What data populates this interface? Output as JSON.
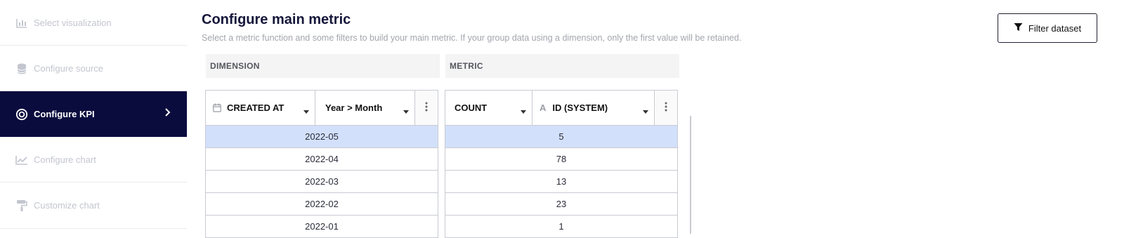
{
  "sidebar": {
    "steps": [
      {
        "label": "Select visualization",
        "icon": "bar-chart-icon",
        "active": false
      },
      {
        "label": "Configure source",
        "icon": "database-icon",
        "active": false
      },
      {
        "label": "Configure KPI",
        "icon": "target-icon",
        "active": true
      },
      {
        "label": "Configure chart",
        "icon": "line-chart-icon",
        "active": false
      },
      {
        "label": "Customize chart",
        "icon": "paint-roller-icon",
        "active": false
      }
    ]
  },
  "header": {
    "title": "Configure main metric",
    "subtitle": "Select a metric function and some filters to build your main metric. If your group data using a dimension, only the first value will be retained.",
    "filter_button": "Filter dataset"
  },
  "dimension": {
    "section_label": "DIMENSION",
    "field": "CREATED AT",
    "grouping": "Year > Month",
    "rows": [
      "2022-05",
      "2022-04",
      "2022-03",
      "2022-02",
      "2022-01"
    ]
  },
  "metric": {
    "section_label": "METRIC",
    "function": "COUNT",
    "field_type_glyph": "A",
    "field": "ID (SYSTEM)",
    "rows": [
      "5",
      "78",
      "13",
      "23",
      "1"
    ]
  },
  "selected_row": 0,
  "colors": {
    "sidebar_active": "#0b0c3e",
    "row_selected": "#d3e0fb"
  }
}
